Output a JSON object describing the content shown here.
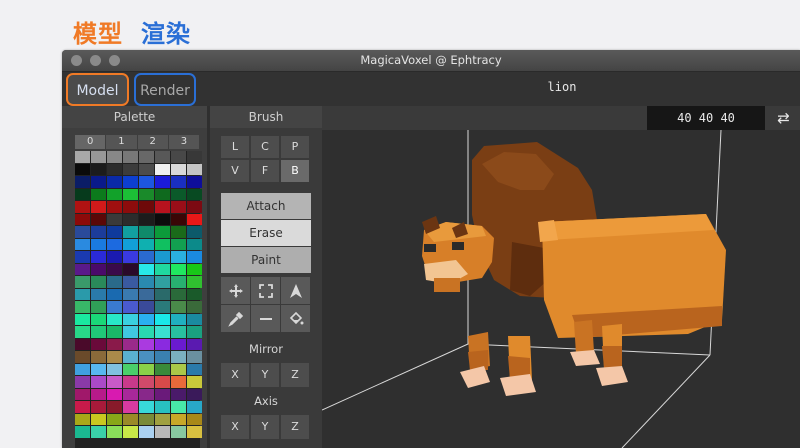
{
  "annotations": {
    "model_cn": "模型",
    "render_cn": "渲染"
  },
  "window": {
    "title": "MagicaVoxel @ Ephtracy"
  },
  "topbar": {
    "model_label": "Model",
    "render_label": "Render",
    "file_name": "lion"
  },
  "palette": {
    "title": "Palette",
    "tabs": [
      "0",
      "1",
      "2",
      "3"
    ],
    "colors": [
      "#a8a8a8",
      "#989898",
      "#888888",
      "#787878",
      "#686868",
      "#585858",
      "#484848",
      "#383838",
      "#0b0b0b",
      "#1c1c1c",
      "#2c2c2c",
      "#3c3c3c",
      "#4c4c4c",
      "#f0f0f0",
      "#d8d8d8",
      "#c4c4c4",
      "#0b1d66",
      "#0a1a8a",
      "#0a2aa8",
      "#0d3fd0",
      "#1d56e0",
      "#1b1bd8",
      "#1a2fc0",
      "#0e0e9a",
      "#063a1c",
      "#0c7a1c",
      "#12a22a",
      "#1cbf36",
      "#1a8a2a",
      "#0f6a1e",
      "#0b5a2a",
      "#084a22",
      "#b01212",
      "#d21a1a",
      "#a00f0f",
      "#8c0c0c",
      "#6e0909",
      "#b8121e",
      "#9a0e18",
      "#7c0a12",
      "#8c0a0a",
      "#5a0808",
      "#3a3a3a",
      "#2c2c2c",
      "#1c1c1c",
      "#0c0c0c",
      "#3a0606",
      "#e81818",
      "#2a4a9a",
      "#1c3c9a",
      "#0f3a9c",
      "#12a0a0",
      "#0f8a6a",
      "#0c9a3a",
      "#1a6a1a",
      "#0c5a6a",
      "#2a8ae0",
      "#1a7ae0",
      "#1c6ae0",
      "#12a0d8",
      "#0fb0b0",
      "#10c060",
      "#12a050",
      "#0c8a8a",
      "#1a3ab0",
      "#2a2ad8",
      "#1a1ab0",
      "#3a3ae0",
      "#2a6ad0",
      "#1a9ad0",
      "#2ab0e0",
      "#1a8ae0",
      "#5a1a8a",
      "#4a0a6a",
      "#3a0a4a",
      "#2a0a2a",
      "#28e8e8",
      "#20d8a0",
      "#20e860",
      "#18c818",
      "#3a9a6a",
      "#2a8a5a",
      "#2a6a8a",
      "#3a5aa0",
      "#2a8ab0",
      "#30a0a0",
      "#28b070",
      "#30c030",
      "#2a9aaa",
      "#2a7aaa",
      "#1a6ab0",
      "#3a7ab0",
      "#3a6a9a",
      "#2a6a6a",
      "#2a6a3a",
      "#1a5a2a",
      "#38b868",
      "#30a058",
      "#3a7ad0",
      "#4a5ad0",
      "#3a4a9a",
      "#2a7a7a",
      "#4a8a4a",
      "#3a6a3a",
      "#1ae8a0",
      "#1ad878",
      "#28e8c8",
      "#3ad0e0",
      "#2ab0f0",
      "#1ae8e8",
      "#20b0c0",
      "#1a8aa0",
      "#28d888",
      "#20c878",
      "#1ab868",
      "#40c8e0",
      "#2ad8b0",
      "#3ae0d0",
      "#28c0a0",
      "#1aa080",
      "#4a0a2a",
      "#6a0a3a",
      "#8a1a4a",
      "#9a2a8a",
      "#aa3ae0",
      "#8a2ae0",
      "#6a1ad0",
      "#5a1ab0",
      "#6a4a2a",
      "#8a6a3a",
      "#aa8a4a",
      "#5ab0d0",
      "#4a90c0",
      "#3a80b0",
      "#7ab0c0",
      "#6a90a0",
      "#40a0e0",
      "#58b8f0",
      "#80c0e0",
      "#4acf6a",
      "#8ad048",
      "#3a8a3a",
      "#aac848",
      "#2a7aaa",
      "#8a3aa8",
      "#aa4ac8",
      "#c85ac8",
      "#c83a8a",
      "#d04a6a",
      "#d84a4a",
      "#e86a3a",
      "#c8c83a",
      "#a0186a",
      "#b81a8a",
      "#d81ab0",
      "#a8289a",
      "#88288a",
      "#6a1a7a",
      "#4a1a6a",
      "#3a1a5a",
      "#c81a4a",
      "#a81a3a",
      "#881a2a",
      "#d83aa0",
      "#38d8d8",
      "#28c0c0",
      "#48e8a8",
      "#28a8c8",
      "#a8a818",
      "#c8c820",
      "#88a818",
      "#9a8a28",
      "#7a8a38",
      "#a0a040",
      "#c8a828",
      "#a88818",
      "#1ab890",
      "#3ad0a8",
      "#8adf5a",
      "#c8e848",
      "#aad0f0",
      "#b8b8b8",
      "#88c8a0",
      "#d8c040"
    ],
    "selected_index": 189
  },
  "brush": {
    "title": "Brush",
    "shape_buttons": [
      {
        "label": "L"
      },
      {
        "label": "C"
      },
      {
        "label": "P"
      },
      {
        "label": "V"
      },
      {
        "label": "F"
      },
      {
        "label": "B",
        "active": true
      }
    ],
    "modes": [
      "Attach",
      "Erase",
      "Paint"
    ],
    "tools": [
      "move-icon",
      "select-icon",
      "pointer-icon",
      "color-picker-icon",
      "minus-icon",
      "fill-icon"
    ],
    "mirror_label": "Mirror",
    "mirror_buttons": [
      "X",
      "Y",
      "Z"
    ],
    "axis_label": "Axis",
    "axis_buttons": [
      "X",
      "Y",
      "Z"
    ]
  },
  "viewport": {
    "dims": "40 40 40",
    "swap_icon": "⇄"
  }
}
